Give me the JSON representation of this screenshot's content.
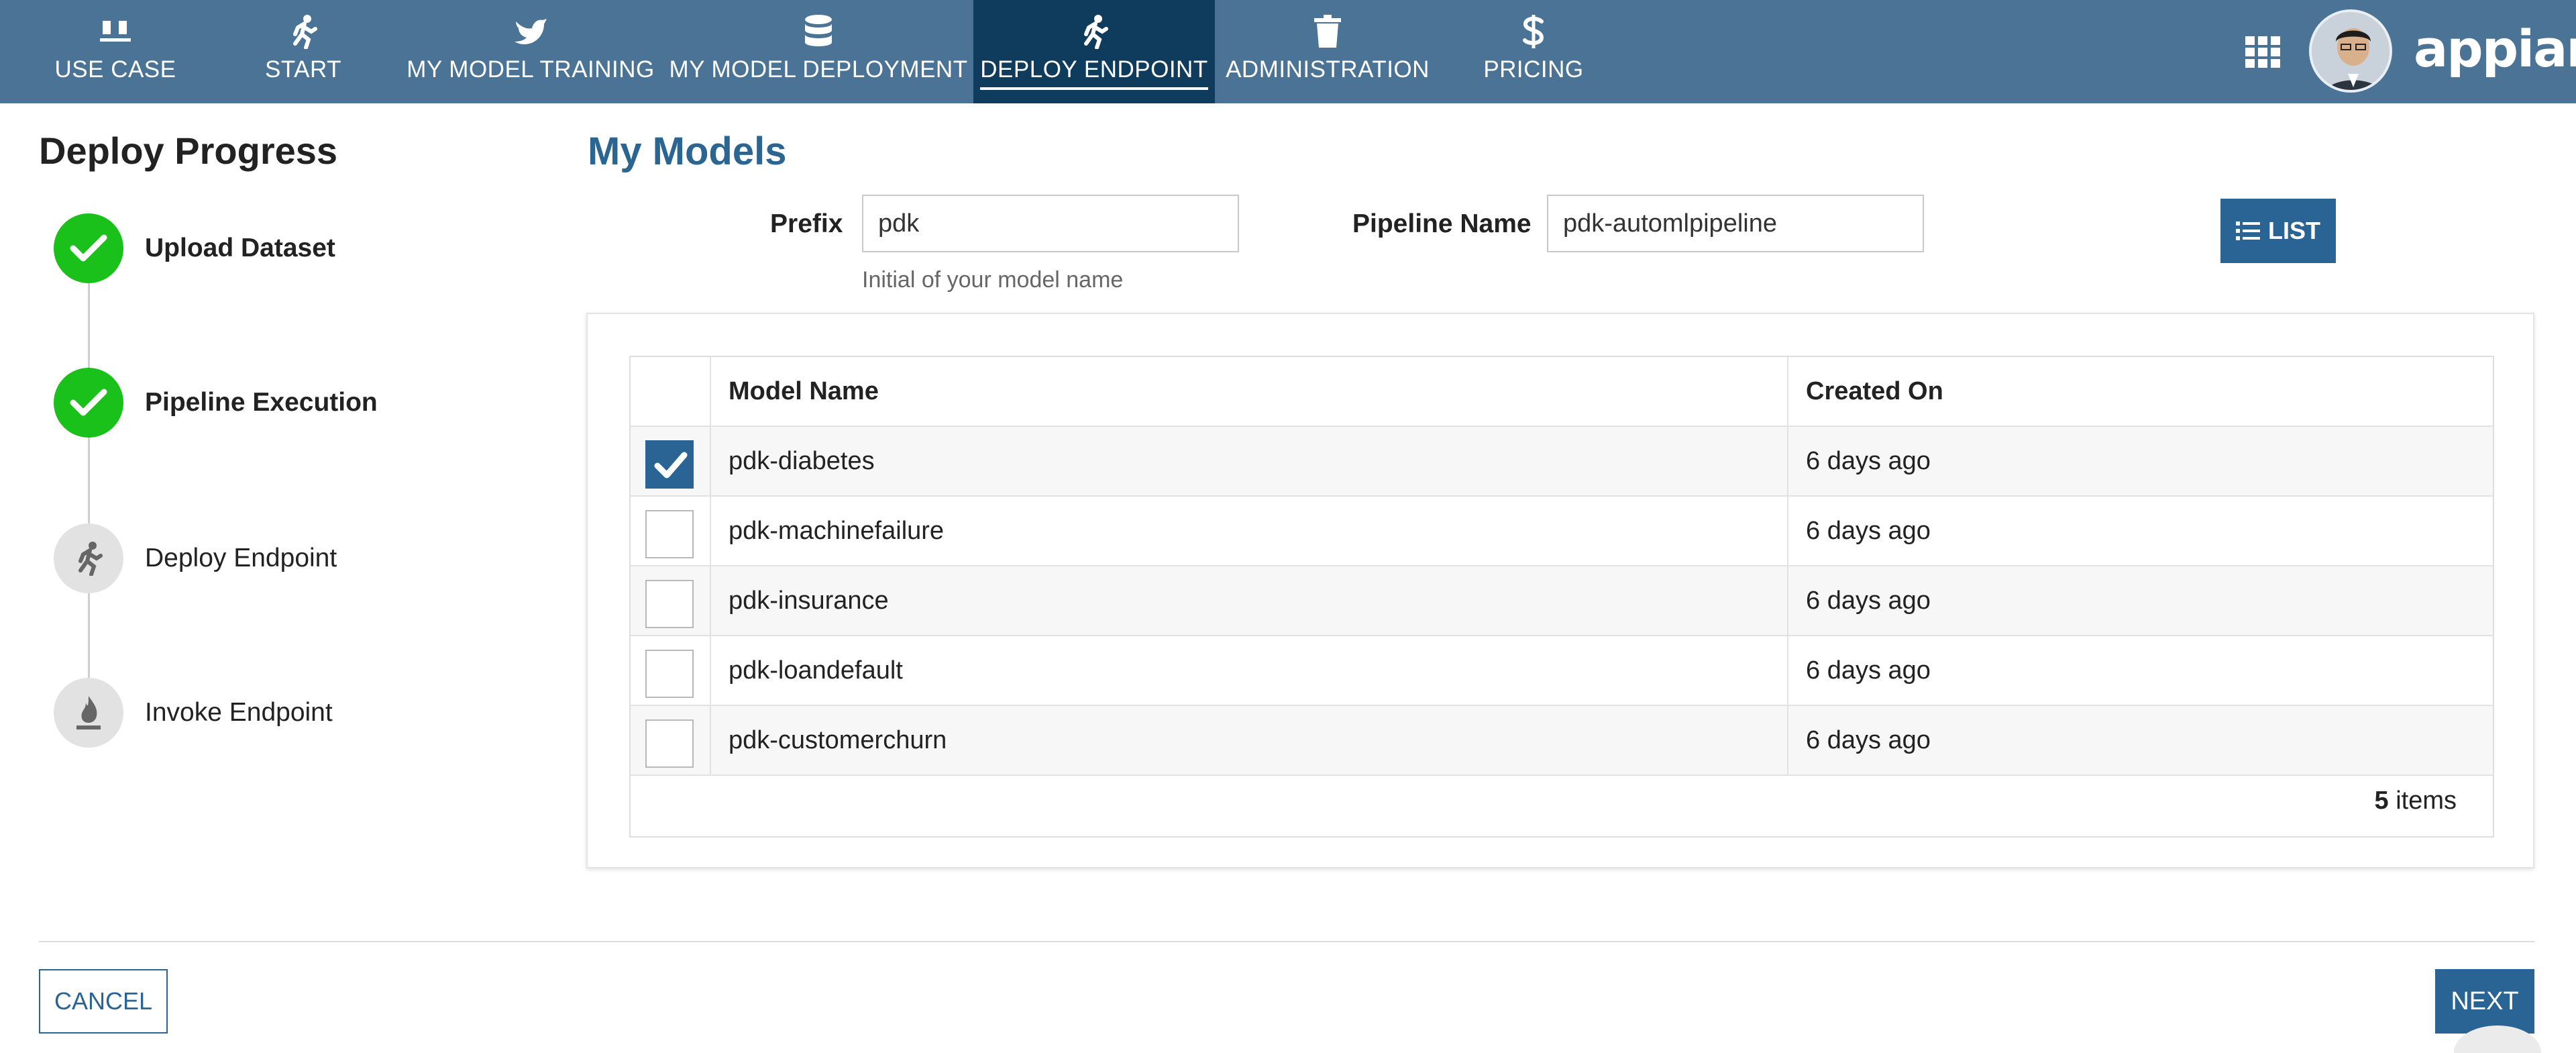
{
  "nav": {
    "tabs": [
      {
        "label": "USE CASE",
        "icon": "cups-icon"
      },
      {
        "label": "START",
        "icon": "running-person-icon"
      },
      {
        "label": "MY MODEL TRAINING",
        "icon": "bird-icon"
      },
      {
        "label": "MY MODEL DEPLOYMENT",
        "icon": "database-icon"
      },
      {
        "label": "DEPLOY ENDPOINT",
        "icon": "running-person-icon",
        "active": true
      },
      {
        "label": "ADMINISTRATION",
        "icon": "trash-icon"
      },
      {
        "label": "PRICING",
        "icon": "dollar-icon"
      }
    ],
    "logo": "appian"
  },
  "progress": {
    "title": "Deploy Progress",
    "steps": [
      {
        "label": "Upload Dataset",
        "status": "done"
      },
      {
        "label": "Pipeline Execution",
        "status": "done"
      },
      {
        "label": "Deploy Endpoint",
        "status": "current"
      },
      {
        "label": "Invoke Endpoint",
        "status": "pending"
      }
    ]
  },
  "main": {
    "title": "My Models",
    "prefix": {
      "label": "Prefix",
      "value": "pdk",
      "helper": "Initial of your model name"
    },
    "pipeline": {
      "label": "Pipeline Name",
      "value": "pdk-automlpipeline"
    },
    "list_button": "LIST"
  },
  "table": {
    "columns": [
      "Model Name",
      "Created On"
    ],
    "rows": [
      {
        "name": "pdk-diabetes",
        "created": "6 days ago",
        "checked": true
      },
      {
        "name": "pdk-machinefailure",
        "created": "6 days ago",
        "checked": false
      },
      {
        "name": "pdk-insurance",
        "created": "6 days ago",
        "checked": false
      },
      {
        "name": "pdk-loandefault",
        "created": "6 days ago",
        "checked": false
      },
      {
        "name": "pdk-customerchurn",
        "created": "6 days ago",
        "checked": false
      }
    ],
    "count": "5",
    "count_suffix": " items"
  },
  "actions": {
    "cancel": "CANCEL",
    "next": "NEXT"
  },
  "colors": {
    "nav_bg": "#4a7396",
    "nav_active": "#0f3b5c",
    "primary": "#2a6494",
    "success": "#1bc11b"
  }
}
